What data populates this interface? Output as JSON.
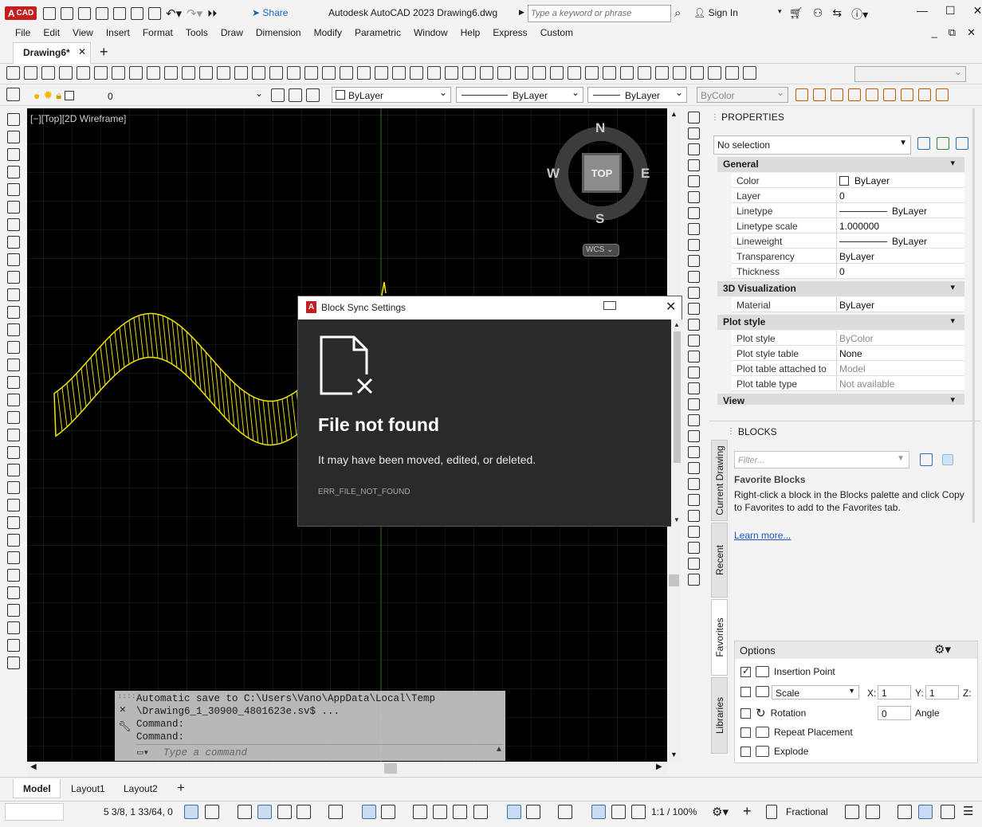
{
  "app": {
    "logo_text": "CAD",
    "share_label": "Share",
    "title": "Autodesk AutoCAD 2023   Drawing6.dwg",
    "search_placeholder": "Type a keyword or phrase",
    "signin_label": "Sign In"
  },
  "menu": [
    "File",
    "Edit",
    "View",
    "Insert",
    "Format",
    "Tools",
    "Draw",
    "Dimension",
    "Modify",
    "Parametric",
    "Window",
    "Help",
    "Express",
    "Custom"
  ],
  "tabs": {
    "drawing": "Drawing6*",
    "close": "✕",
    "new": "+"
  },
  "layers": {
    "current_layer": "0",
    "color": "ByLayer",
    "linetype": "ByLayer",
    "lineweight": "ByLayer",
    "plotstyle": "ByColor"
  },
  "viewport": {
    "label": "[−][Top][2D Wireframe]",
    "compass": {
      "n": "N",
      "s": "S",
      "e": "E",
      "w": "W",
      "top": "TOP",
      "wcs": "WCS"
    }
  },
  "command": {
    "history": "Automatic save to C:\\Users\\Vano\\AppData\\Local\\Temp\n\\Drawing6_1_30900_4801623e.sv$ ...\nCommand:\nCommand:",
    "placeholder": "Type a command"
  },
  "dialog": {
    "title": "Block Sync Settings",
    "heading": "File not found",
    "message": "It may have been moved, edited, or deleted.",
    "code": "ERR_FILE_NOT_FOUND"
  },
  "properties": {
    "title": "PROPERTIES",
    "selection": "No selection",
    "general": "General",
    "rows_general": [
      {
        "k": "Color",
        "v": "ByLayer"
      },
      {
        "k": "Layer",
        "v": "0"
      },
      {
        "k": "Linetype",
        "v": "ByLayer"
      },
      {
        "k": "Linetype scale",
        "v": "1.000000"
      },
      {
        "k": "Lineweight",
        "v": "ByLayer"
      },
      {
        "k": "Transparency",
        "v": "ByLayer"
      },
      {
        "k": "Thickness",
        "v": "0"
      }
    ],
    "viz": "3D Visualization",
    "rows_viz": [
      {
        "k": "Material",
        "v": "ByLayer"
      }
    ],
    "plot": "Plot style",
    "rows_plot": [
      {
        "k": "Plot style",
        "v": "ByColor"
      },
      {
        "k": "Plot style table",
        "v": "None"
      },
      {
        "k": "Plot table attached to",
        "v": "Model"
      },
      {
        "k": "Plot table type",
        "v": "Not available"
      }
    ],
    "view": "View"
  },
  "blocks": {
    "title": "BLOCKS",
    "filter": "Filter...",
    "fav_title": "Favorite Blocks",
    "fav_text": "Right-click a block in the Blocks palette and click Copy to Favorites to add to the Favorites tab.",
    "learn": "Learn more...",
    "vtabs": [
      "Current Drawing",
      "Recent",
      "Favorites",
      "Libraries"
    ],
    "options": "Options",
    "insertion": "Insertion Point",
    "scale": "Scale",
    "x_label": "X:",
    "x_val": "1",
    "y_label": "Y:",
    "y_val": "1",
    "z_label": "Z:",
    "rotation": "Rotation",
    "angle_val": "0",
    "angle_label": "Angle",
    "repeat": "Repeat Placement",
    "explode": "Explode"
  },
  "layout_tabs": [
    "Model",
    "Layout1",
    "Layout2",
    "+"
  ],
  "status": {
    "coords": "5 3/8, 1 33/64, 0",
    "scale": "1:1 / 100%",
    "units": "Fractional"
  }
}
